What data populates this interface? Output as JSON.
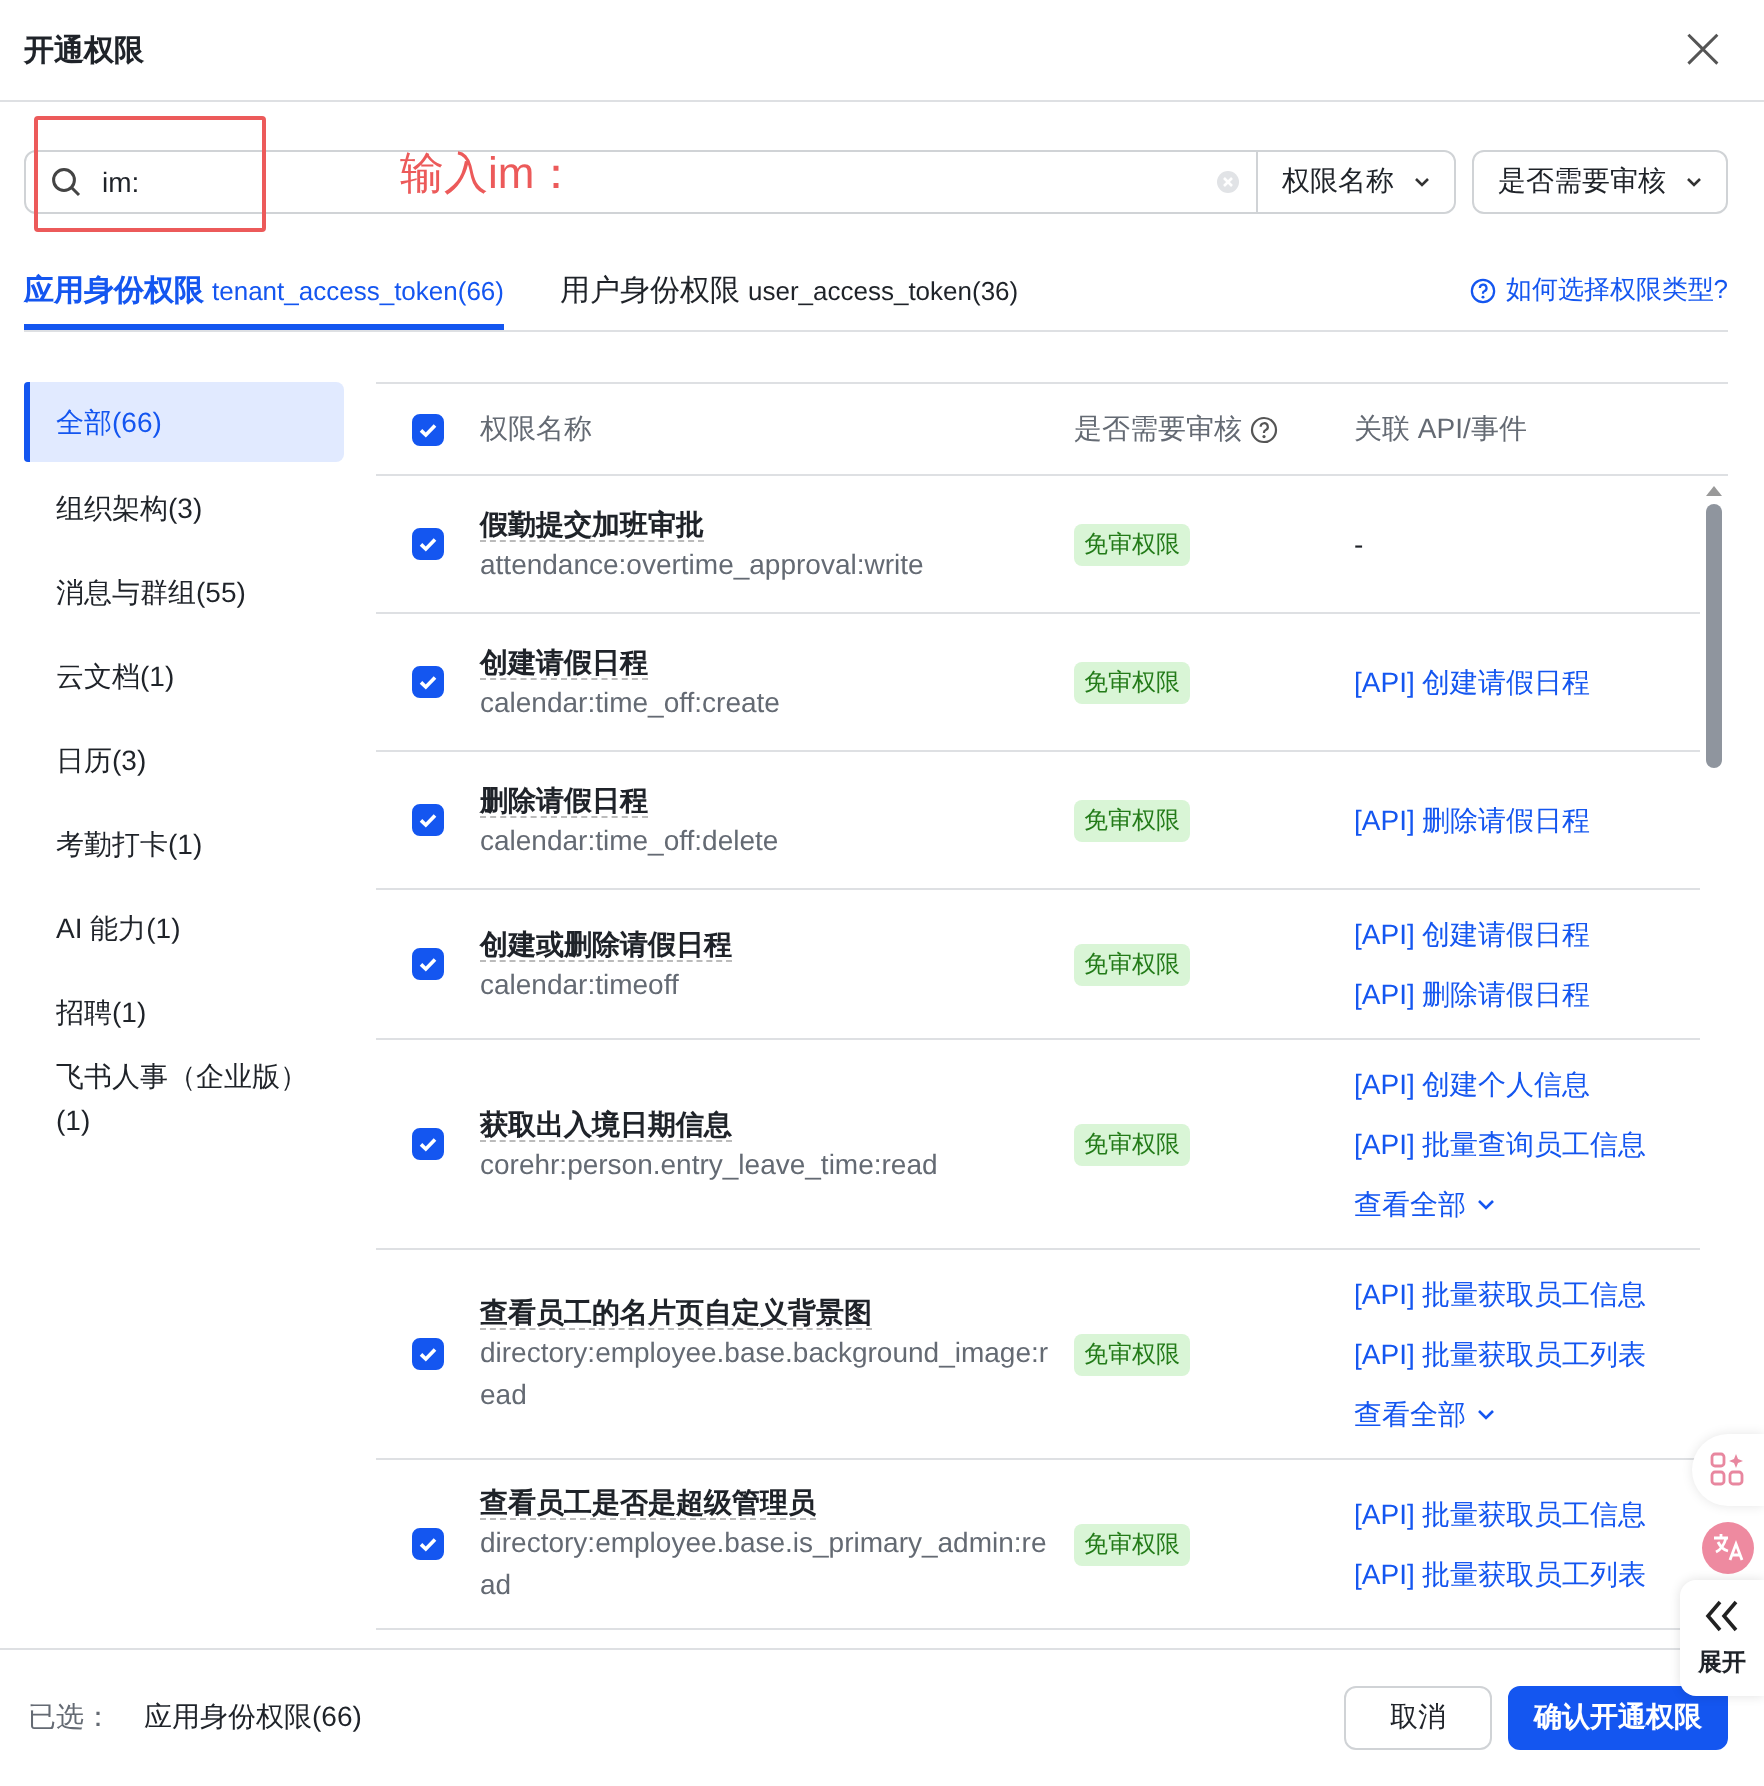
{
  "dialog": {
    "title": "开通权限",
    "close": "×"
  },
  "search": {
    "value": "im:",
    "annotation": "输入im：",
    "filters": [
      "权限名称",
      "是否需要审核"
    ]
  },
  "tabs": [
    {
      "label": "应用身份权限",
      "token": "tenant_access_token(66)",
      "selected": true
    },
    {
      "label": "用户身份权限",
      "token": "user_access_token(36)",
      "selected": false
    }
  ],
  "help_link": "如何选择权限类型?",
  "sidebar": {
    "items": [
      {
        "label": "全部(66)",
        "selected": true
      },
      {
        "label": "组织架构(3)",
        "selected": false
      },
      {
        "label": "消息与群组(55)",
        "selected": false
      },
      {
        "label": "云文档(1)",
        "selected": false
      },
      {
        "label": "日历(3)",
        "selected": false
      },
      {
        "label": "考勤打卡(1)",
        "selected": false
      },
      {
        "label": "AI 能力(1)",
        "selected": false
      },
      {
        "label": "招聘(1)",
        "selected": false
      },
      {
        "label": "飞书人事（企业版）(1)",
        "selected": false
      }
    ]
  },
  "table": {
    "all_checked": true,
    "columns": [
      "权限名称",
      "是否需要审核",
      "关联 API/事件"
    ],
    "rows": [
      {
        "checked": true,
        "name": "假勤提交加班审批",
        "scope": "attendance:overtime_approval:write",
        "review": "免审权限",
        "apis": [
          "-"
        ]
      },
      {
        "checked": true,
        "name": "创建请假日程",
        "scope": "calendar:time_off:create",
        "review": "免审权限",
        "apis": [
          "[API] 创建请假日程"
        ]
      },
      {
        "checked": true,
        "name": "删除请假日程",
        "scope": "calendar:time_off:delete",
        "review": "免审权限",
        "apis": [
          "[API] 删除请假日程"
        ]
      },
      {
        "checked": true,
        "name": "创建或删除请假日程",
        "scope": "calendar:timeoff",
        "review": "免审权限",
        "apis": [
          "[API] 创建请假日程",
          "[API] 删除请假日程"
        ]
      },
      {
        "checked": true,
        "name": "获取出入境日期信息",
        "scope": "corehr:person.entry_leave_time:read",
        "review": "免审权限",
        "apis": [
          "[API] 创建个人信息",
          "[API] 批量查询员工信息"
        ],
        "view_all": "查看全部"
      },
      {
        "checked": true,
        "name": "查看员工的名片页自定义背景图",
        "scope": "directory:employee.base.background_image:read",
        "review": "免审权限",
        "apis": [
          "[API] 批量获取员工信息",
          "[API] 批量获取员工列表"
        ],
        "view_all": "查看全部"
      },
      {
        "checked": true,
        "name": "查看员工是否是超级管理员",
        "scope": "directory:employee.base.is_primary_admin:read",
        "review": "免审权限",
        "apis": [
          "[API] 批量获取员工信息",
          "[API] 批量获取员工列表"
        ]
      }
    ]
  },
  "expand_label": "展开",
  "footer": {
    "selected_label": "已选：",
    "selected_value": "应用身份权限(66)",
    "buttons": [
      "取消",
      "确认开通权限"
    ]
  }
}
